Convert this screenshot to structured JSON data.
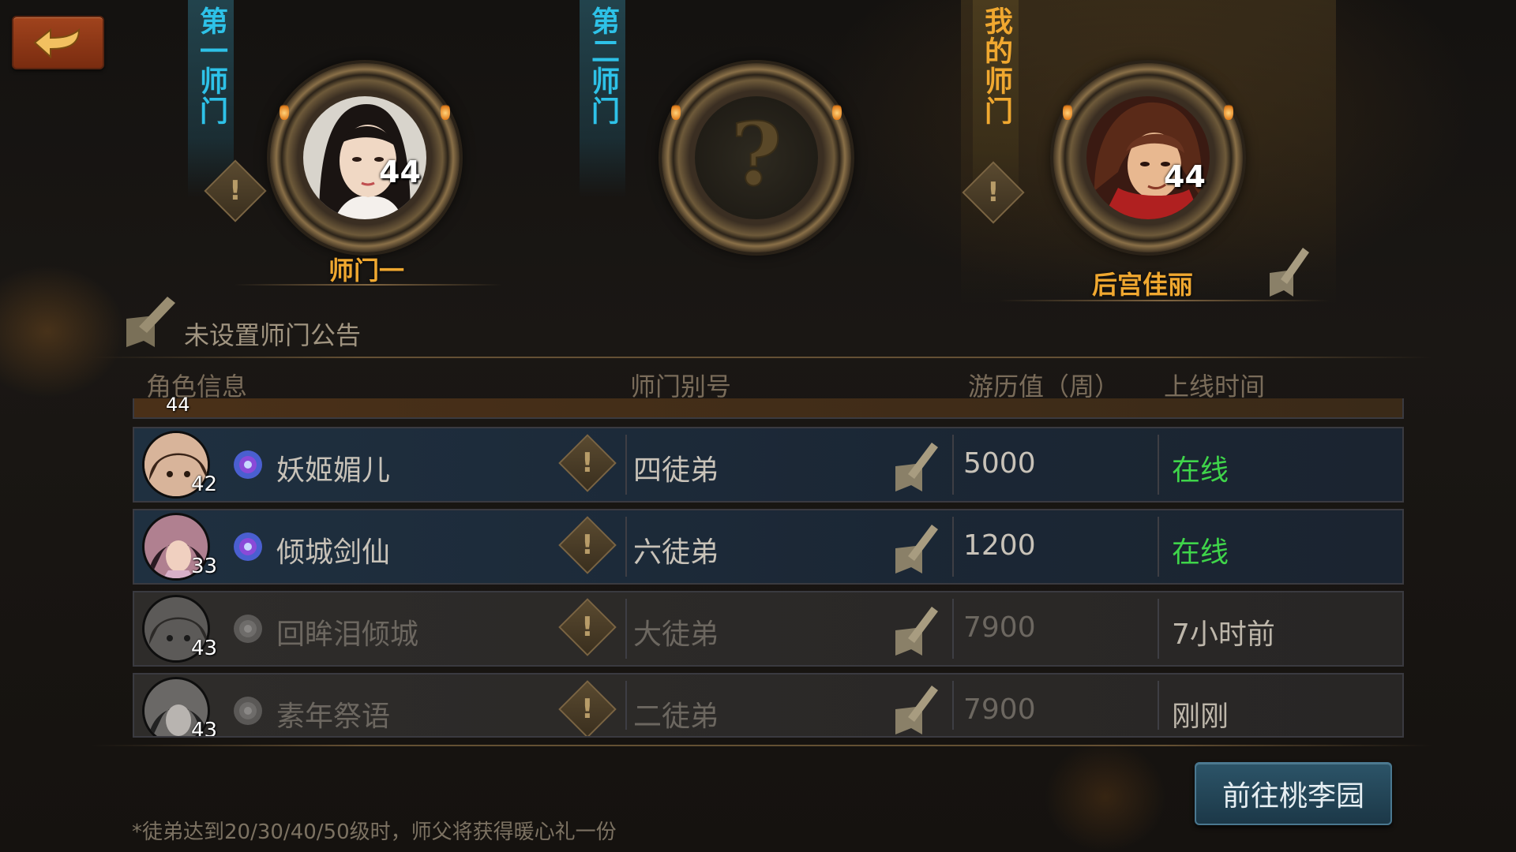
{
  "top": {
    "back_button": {
      "icon": "back-arrow-icon"
    },
    "sects": [
      {
        "banner": "第一师门",
        "name": "师门一",
        "level": "44"
      },
      {
        "banner": "第二师门",
        "name": "",
        "level": ""
      },
      {
        "banner": "我的师门",
        "name": "后宫佳丽",
        "level": "44"
      }
    ],
    "notice": "未设置师门公告"
  },
  "table": {
    "headers": [
      "角色信息",
      "师门别号",
      "游历值（周）",
      "上线时间"
    ],
    "partial_row": {
      "level": "44"
    },
    "rows": [
      {
        "name": "妖姬媚儿",
        "level": "42",
        "alias": "四徒弟",
        "xp": "5000",
        "online": "在线",
        "status": "online"
      },
      {
        "name": "倾城剑仙",
        "level": "33",
        "alias": "六徒弟",
        "xp": "1200",
        "online": "在线",
        "status": "online"
      },
      {
        "name": "回眸泪倾城",
        "level": "43",
        "alias": "大徒弟",
        "xp": "7900",
        "online": "7小时前",
        "status": "offline"
      },
      {
        "name": "素年祭语",
        "level": "43",
        "alias": "二徒弟",
        "xp": "7900",
        "online": "刚刚",
        "status": "offline"
      }
    ]
  },
  "footer": {
    "go_button": "前往桃李园",
    "footnote": "*徒弟达到20/30/40/50级时，师父将获得暖心礼一份"
  },
  "colors": {
    "accent_gold": "#f0a830",
    "accent_cyan": "#2ec2e8",
    "online_green": "#3fd54a"
  }
}
